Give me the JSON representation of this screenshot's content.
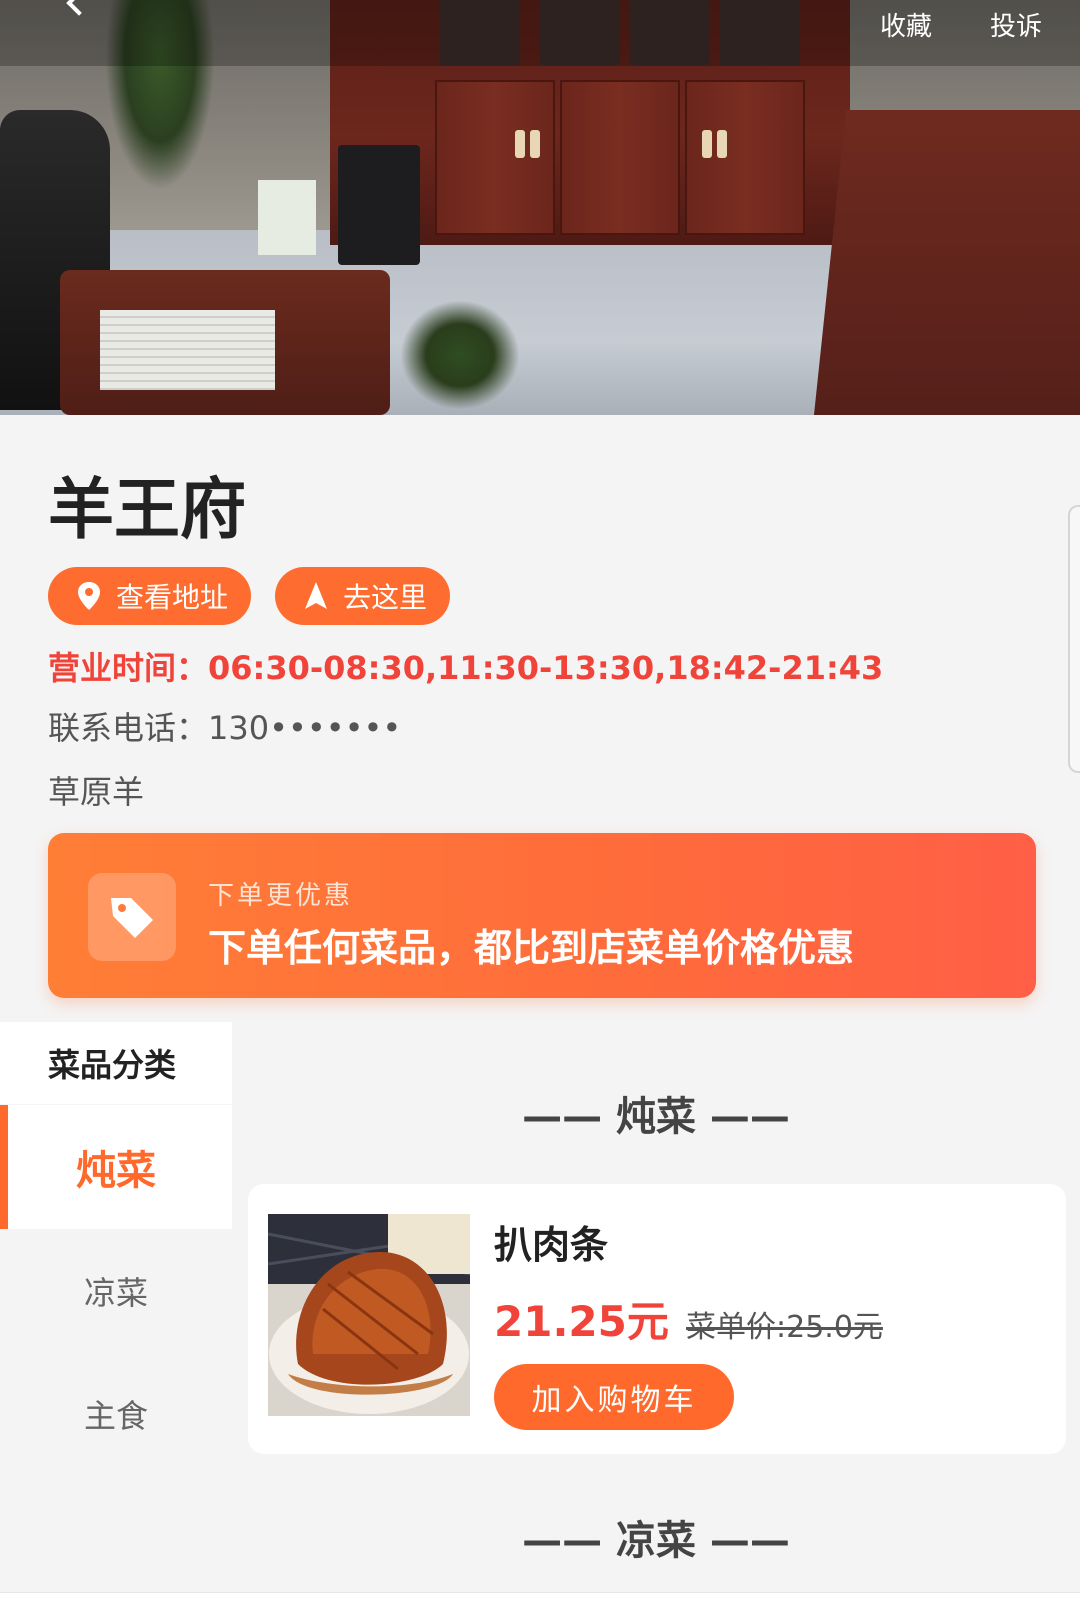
{
  "header": {
    "favorite_label": "收藏",
    "complain_label": "投诉"
  },
  "store": {
    "name": "羊王府",
    "view_address_label": "查看地址",
    "navigate_label": "去这里",
    "hours": "营业时间：06:30-08:30,11:30-13:30,18:42-21:43",
    "phone": "联系电话：130•••••••",
    "description": "草原羊"
  },
  "promo": {
    "subtitle": "下单更优惠",
    "title": "下单任何菜品，都比到店菜单价格优惠"
  },
  "categories": {
    "header": "菜品分类",
    "items": [
      {
        "label": "炖菜",
        "active": true
      },
      {
        "label": "凉菜",
        "active": false
      },
      {
        "label": "主食",
        "active": false
      }
    ]
  },
  "menu": {
    "sections": [
      {
        "title": "—— 炖菜 ——"
      },
      {
        "title": "—— 凉菜 ——"
      }
    ],
    "dishes": [
      {
        "name": "扒肉条",
        "price": "21.25元",
        "original_price": "菜单价:25.0元",
        "add_label": "加入购物车"
      }
    ]
  },
  "colors": {
    "accent": "#ff6a2c",
    "price_red": "#f0433a"
  },
  "icons": {
    "back": "back-icon",
    "location": "location-pin-icon",
    "navigate": "navigation-arrow-icon",
    "promo": "tag-icon"
  }
}
